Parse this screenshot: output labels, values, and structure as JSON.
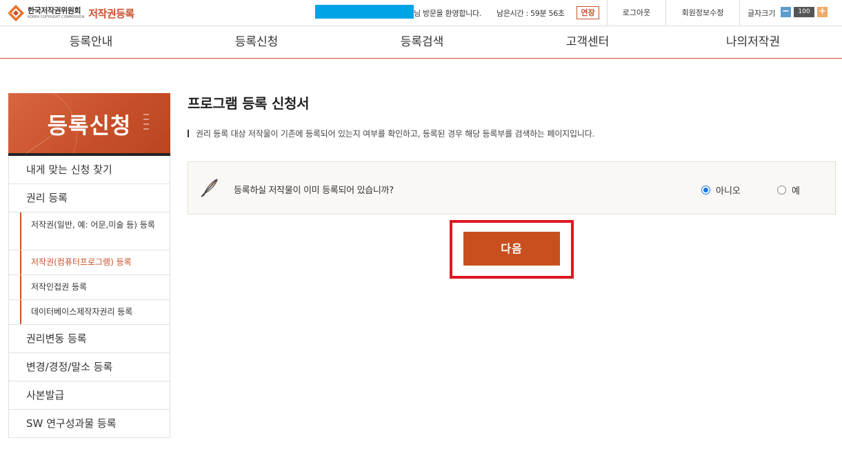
{
  "header": {
    "logo_ko": "한국저작권위원회",
    "logo_en": "KOREA COPYRIGHT COMMISSION",
    "service_name": "저작권등록",
    "welcome_text": "님 방문을 환영합니다.",
    "remaining_time": "남은시간 : 59분 56초",
    "extend_label": "연장",
    "logout_label": "로그아웃",
    "member_edit_label": "회원정보수정",
    "font_size_label": "글자크기",
    "font_size_minus": "−",
    "font_size_value": "100",
    "font_size_plus": "+"
  },
  "nav": {
    "items": [
      {
        "label": "등록안내"
      },
      {
        "label": "등록신청"
      },
      {
        "label": "등록검색"
      },
      {
        "label": "고객센터"
      },
      {
        "label": "나의저작권"
      }
    ]
  },
  "sidebar": {
    "banner_title": "등록신청",
    "items": [
      {
        "label": "내게 맞는 신청 찾기"
      },
      {
        "label": "권리 등록"
      },
      {
        "label": "저작권(일반, 예: 어문,미술 등) 등록"
      },
      {
        "label": "저작권(컴퓨터프로그램) 등록"
      },
      {
        "label": "저작인접권 등록"
      },
      {
        "label": "데이터베이스제작자권리 등록"
      },
      {
        "label": "권리변동 등록"
      },
      {
        "label": "변경/경정/말소 등록"
      },
      {
        "label": "사본발급"
      },
      {
        "label": "SW 연구성과물 등록"
      }
    ]
  },
  "main": {
    "title": "프로그램 등록 신청서",
    "description": "권리 등록 대상 저작물이 기존에 등록되어 있는지 여부를 확인하고, 등록된 경우 해당 등록부를 검색하는 페이지입니다.",
    "question": "등록하실 저작물이 이미 등록되어 있습니까?",
    "options": [
      {
        "label": "아니오",
        "selected": true
      },
      {
        "label": "예",
        "selected": false
      }
    ],
    "next_label": "다음"
  },
  "colors": {
    "accent": "#c8502a",
    "highlight": "#e0151f",
    "user_mask": "#00a3e6",
    "radio_selected": "#1a73e8"
  },
  "icons": {
    "logo": "logo-mark-icon",
    "question": "quill-pen-icon"
  }
}
